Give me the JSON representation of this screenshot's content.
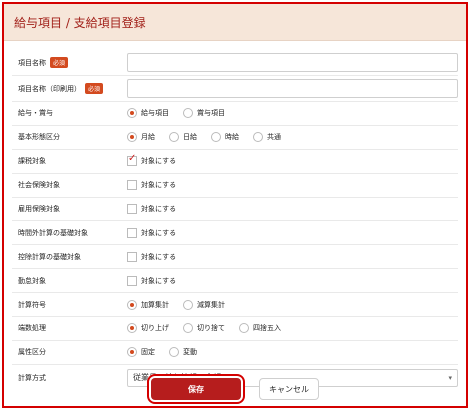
{
  "header": {
    "title": "給与項目 / 支給項目登録"
  },
  "form": {
    "required_badge": "必須",
    "rows": [
      {
        "label": "項目名称",
        "required": true,
        "type": "input"
      },
      {
        "label": "項目名称（印刷用）",
        "required": true,
        "type": "input"
      },
      {
        "label": "給与・賞与",
        "type": "radio",
        "options": [
          "給与項目",
          "賞与項目"
        ],
        "selected": 0
      },
      {
        "label": "基本形態区分",
        "type": "radio",
        "options": [
          "月給",
          "日給",
          "時給",
          "共通"
        ],
        "selected": 0
      },
      {
        "label": "課税対象",
        "type": "check",
        "option": "対象にする",
        "checked": true
      },
      {
        "label": "社会保険対象",
        "type": "check",
        "option": "対象にする",
        "checked": false
      },
      {
        "label": "雇用保険対象",
        "type": "check",
        "option": "対象にする",
        "checked": false
      },
      {
        "label": "時間外計算の基礎対象",
        "type": "check",
        "option": "対象にする",
        "checked": false
      },
      {
        "label": "控除計算の基礎対象",
        "type": "check",
        "option": "対象にする",
        "checked": false
      },
      {
        "label": "勤怠対象",
        "type": "check",
        "option": "対象にする",
        "checked": false
      },
      {
        "label": "計算符号",
        "type": "radio",
        "options": [
          "加算集計",
          "減算集計"
        ],
        "selected": 0
      },
      {
        "label": "端数処理",
        "type": "radio",
        "options": [
          "切り上げ",
          "切り捨て",
          "四捨五入"
        ],
        "selected": 0
      },
      {
        "label": "属性区分",
        "type": "radio",
        "options": [
          "固定",
          "変動"
        ],
        "selected": 0
      },
      {
        "label": "計算方式",
        "type": "select",
        "value": "従業員の給与情報の金額"
      }
    ]
  },
  "actions": {
    "save_label": "保存",
    "cancel_label": "キャンセル"
  },
  "colors": {
    "accent": "#b61d1d",
    "highlight": "#d40000",
    "header_bg": "#f6e6d9"
  }
}
